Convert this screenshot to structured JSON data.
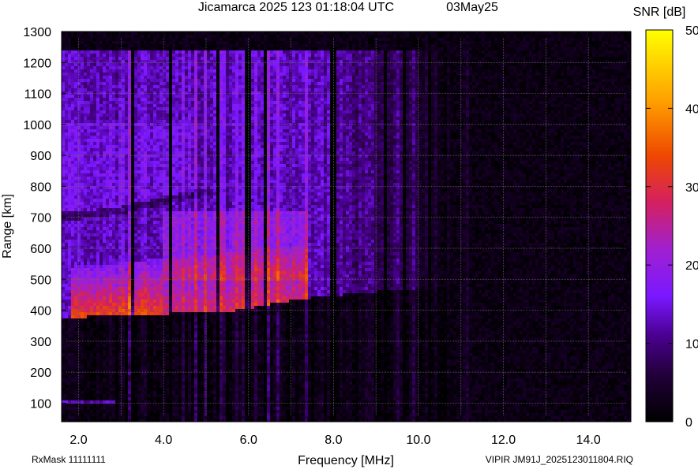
{
  "chart_data": {
    "type": "heatmap",
    "title": "Jicamarca 2025 123 01:18:04 UTC",
    "date_label": "03May25",
    "xlabel": "Frequency [MHz]",
    "ylabel": "Range [km]",
    "xlim": [
      1.6,
      15.0
    ],
    "ylim": [
      40,
      1300
    ],
    "x_ticks": [
      2.0,
      4.0,
      6.0,
      8.0,
      10.0,
      12.0,
      14.0
    ],
    "x_tick_labels": [
      "2.0",
      "4.0",
      "6.0",
      "8.0",
      "10.0",
      "12.0",
      "14.0"
    ],
    "y_ticks": [
      100,
      200,
      300,
      400,
      500,
      600,
      700,
      800,
      900,
      1000,
      1100,
      1200,
      1300
    ],
    "y_tick_labels": [
      "100",
      "200",
      "300",
      "400",
      "500",
      "600",
      "700",
      "800",
      "900",
      "1000",
      "1100",
      "1200",
      "1300"
    ],
    "data_range": {
      "range_max_km": 1240
    },
    "grid": true,
    "colorbar": {
      "label": "SNR [dB]",
      "min": 0,
      "max": 50,
      "ticks": [
        0,
        10,
        20,
        30,
        40,
        50
      ],
      "tick_labels": [
        "0",
        "10",
        "20",
        "30",
        "40",
        "50"
      ],
      "colors": [
        "#000000",
        "#3a0068",
        "#7a10ff",
        "#c21a9a",
        "#f04a00",
        "#ffd400"
      ]
    },
    "features": {
      "trace_lower_edge": [
        [
          1.8,
          375
        ],
        [
          3.0,
          385
        ],
        [
          4.5,
          390
        ],
        [
          5.8,
          400
        ],
        [
          6.5,
          420
        ],
        [
          7.5,
          440
        ],
        [
          9.0,
          460
        ],
        [
          10.0,
          465
        ],
        [
          11.0,
          480
        ]
      ],
      "strong_echo_band": {
        "freq_range": [
          1.8,
          7.4
        ],
        "range_km": [
          370,
          540
        ],
        "peak_snr_db": 32
      },
      "multihop_edge": [
        [
          1.9,
          700
        ],
        [
          3.0,
          720
        ],
        [
          4.0,
          750
        ],
        [
          5.0,
          780
        ]
      ],
      "weak_trace_at_100km": {
        "freq_range": [
          1.9,
          2.9
        ],
        "range_km": 100
      }
    },
    "bright_columns_mhz": [
      3.2,
      4.45,
      4.72,
      4.95,
      5.35,
      5.7,
      5.85,
      6.0,
      6.15,
      6.4,
      6.65,
      7.3,
      9.5,
      9.85,
      11.1
    ],
    "dark_columns_mhz": [
      3.25,
      4.15,
      5.25,
      5.95,
      6.35,
      7.95,
      9.2,
      9.65,
      10.2
    ]
  },
  "footer": {
    "left": "RxMask 11111111",
    "right": "VIPIR  JM91J_2025123011804.RIQ"
  }
}
